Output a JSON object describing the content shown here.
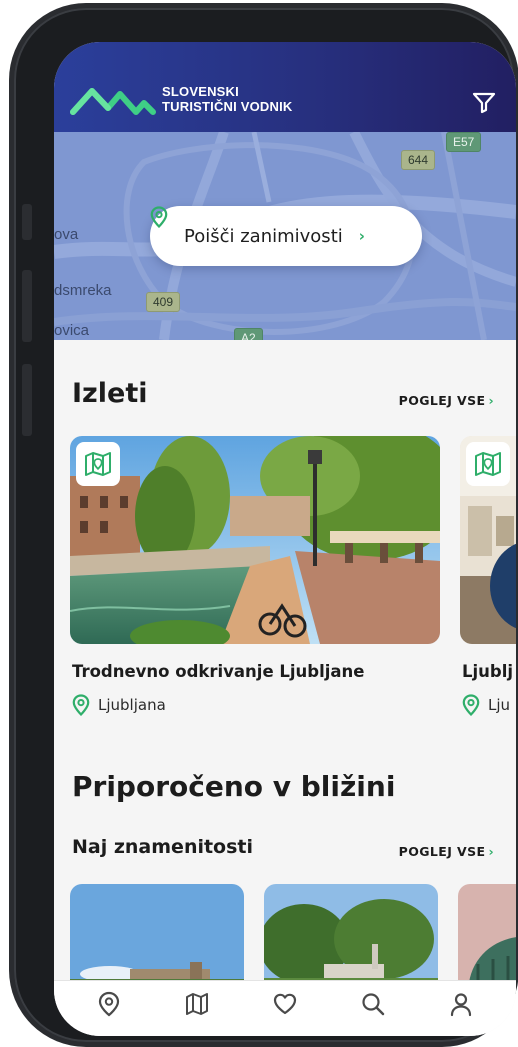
{
  "header": {
    "brand_line1": "SLOVENSKI",
    "brand_line2": "TURISTIČNI VODNIK",
    "filter_icon": "filter-icon"
  },
  "map": {
    "labels": [
      "ova",
      "dsmreka",
      "ovica"
    ],
    "road_signs": [
      "644",
      "E57",
      "409",
      "A2"
    ],
    "search_button_label": "Poišči zanimivosti",
    "search_icon": "location-pin-icon"
  },
  "izleti": {
    "title": "Izleti",
    "see_all": "POGLEJ VSE",
    "cards": [
      {
        "title": "Trodnevno odkrivanje Ljubljane",
        "location": "Ljubljana",
        "badge_icon": "map-icon"
      },
      {
        "title": "Ljublj",
        "location": "Lju",
        "badge_icon": "map-icon"
      }
    ]
  },
  "nearby": {
    "title": "Priporočeno v bližini",
    "subsection_title": "Naj znamenitosti",
    "see_all": "POGLEJ VSE"
  },
  "bottom_nav": {
    "items": [
      {
        "icon": "location-pin-icon",
        "label": ""
      },
      {
        "icon": "map-icon",
        "label": ""
      },
      {
        "icon": "heart-icon",
        "label": ""
      },
      {
        "icon": "search-icon",
        "label": ""
      },
      {
        "icon": "user-icon",
        "label": ""
      }
    ]
  },
  "colors": {
    "header_start": "#2b3f9b",
    "header_end": "#221f62",
    "accent_green": "#2fae6a",
    "map_blue": "#7e95cf"
  }
}
